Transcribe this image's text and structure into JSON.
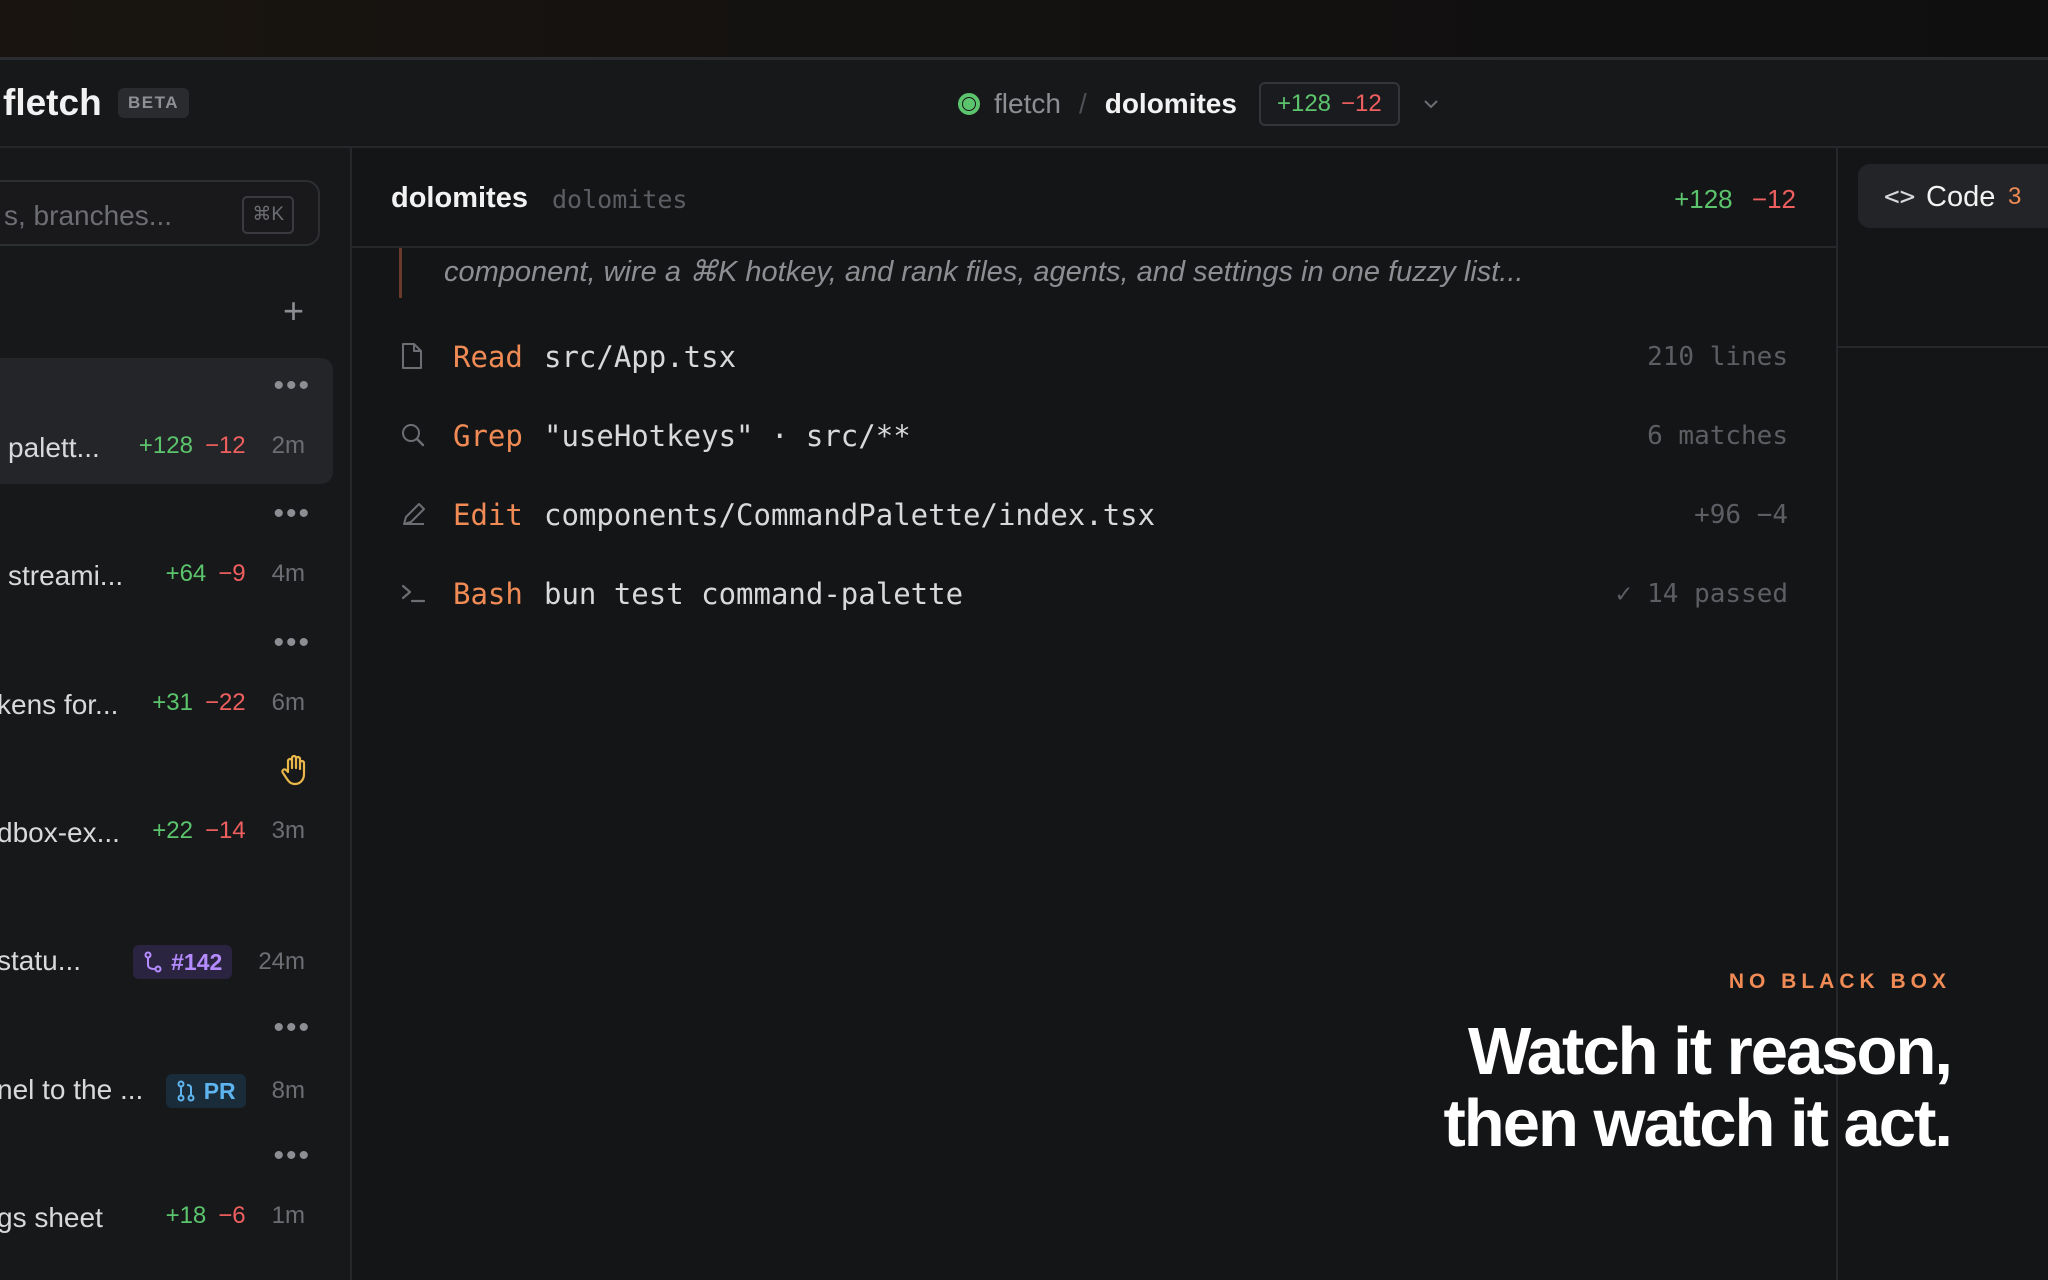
{
  "header": {
    "brand": "fletch",
    "badge": "BETA",
    "repo": "fletch",
    "separator": "/",
    "branch": "dolomites",
    "additions": "+128",
    "deletions": "−12"
  },
  "sidebar": {
    "search_placeholder": "s, branches...",
    "shortcut": "⌘K",
    "sessions": [
      {
        "title": "palett...",
        "additions": "+128",
        "deletions": "−12",
        "time": "2m",
        "active": true
      },
      {
        "title": "streami...",
        "additions": "+64",
        "deletions": "−9",
        "time": "4m"
      },
      {
        "title": "kens for...",
        "additions": "+31",
        "deletions": "−22",
        "time": "6m"
      },
      {
        "title": "dbox-ex...",
        "additions": "+22",
        "deletions": "−14",
        "time": "3m",
        "icon": "hand-icon"
      },
      {
        "title": "statu...",
        "badge": "#142",
        "time": "24m"
      },
      {
        "title": "nel to the ...",
        "badge": "PR",
        "time": "8m"
      },
      {
        "title": "gs sheet",
        "additions": "+18",
        "deletions": "−6",
        "time": "1m"
      }
    ]
  },
  "main": {
    "title": "dolomites",
    "subtitle": "dolomites",
    "additions": "+128",
    "deletions": "−12",
    "thinking": "component, wire a ⌘K hotkey, and rank files, agents, and settings in one fuzzy list...",
    "tools": [
      {
        "name": "Read",
        "arg": "src/App.tsx",
        "result": "210 lines",
        "icon": "file-icon"
      },
      {
        "name": "Grep",
        "arg": "\"useHotkeys\" · src/**",
        "result": "6 matches",
        "icon": "search-icon"
      },
      {
        "name": "Edit",
        "arg": "components/CommandPalette/index.tsx",
        "result": "+96 −4",
        "icon": "pencil-icon"
      },
      {
        "name": "Bash",
        "arg": "bun test command-palette",
        "result": "✓ 14 passed",
        "icon": "terminal-icon"
      }
    ]
  },
  "right_panel": {
    "tab_icon": "<>",
    "tab_label": "Code",
    "tab_count": "3"
  },
  "tagline": {
    "kicker": "NO BLACK BOX",
    "line1": "Watch it reason,",
    "line2": "then watch it act."
  },
  "colors": {
    "accent": "#f08b55",
    "add": "#5bc46c",
    "del": "#ef5f5f",
    "status": "#5bc46c",
    "pr_purple": "#b58cff",
    "pr_blue": "#5db4ee"
  }
}
